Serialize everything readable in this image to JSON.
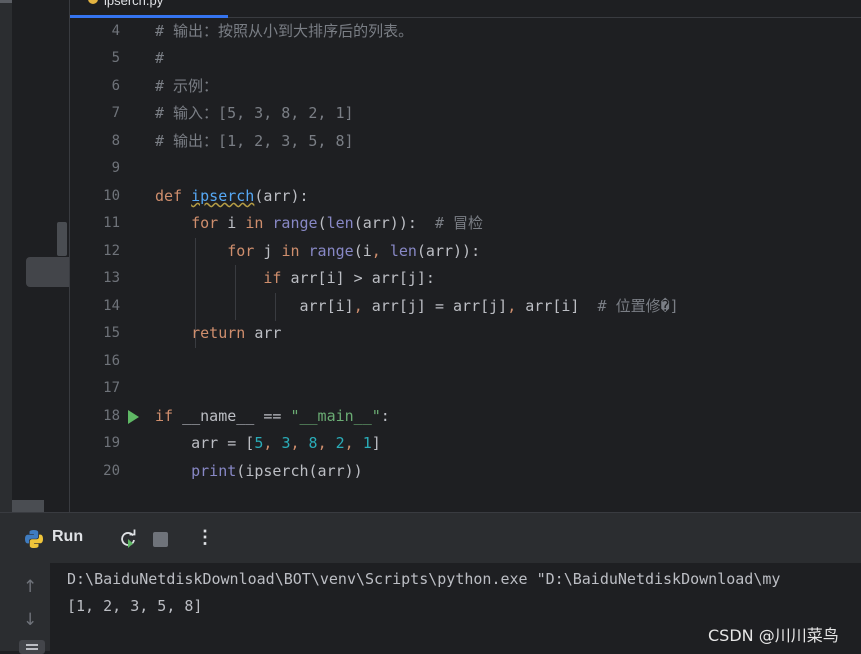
{
  "editor": {
    "active_tab": {
      "label": "ipserch.py"
    },
    "lines": [
      {
        "num": "4",
        "text": "# 输出：按照从小到大排序后的列表。"
      },
      {
        "num": "5",
        "text": "#"
      },
      {
        "num": "6",
        "text": "# 示例："
      },
      {
        "num": "7",
        "text": "# 输入：[5, 3, 8, 2, 1]"
      },
      {
        "num": "8",
        "text": "# 输出：[1, 2, 3, 5, 8]"
      },
      {
        "num": "9",
        "text": ""
      },
      {
        "num": "10",
        "text": "def ipserch(arr):"
      },
      {
        "num": "11",
        "text": "    for i in range(len(arr)):  # 冒检"
      },
      {
        "num": "12",
        "text": "        for j in range(i, len(arr)):"
      },
      {
        "num": "13",
        "text": "            if arr[i] > arr[j]:"
      },
      {
        "num": "14",
        "text": "                arr[i], arr[j] = arr[j], arr[i]  # 位置修�]"
      },
      {
        "num": "15",
        "text": "    return arr"
      },
      {
        "num": "16",
        "text": ""
      },
      {
        "num": "17",
        "text": ""
      },
      {
        "num": "18",
        "text": "if __name__ == \"__main__\":"
      },
      {
        "num": "19",
        "text": "    arr = [5, 3, 8, 2, 1]"
      },
      {
        "num": "20",
        "text": "    print(ipserch(arr))"
      }
    ]
  },
  "run_panel": {
    "title": "Run",
    "icons": [
      "python-icon",
      "rerun-icon",
      "stop-icon",
      "more-options-icon",
      "scroll-up-icon",
      "scroll-down-icon",
      "soft-wrap-icon"
    ],
    "console": [
      "D:\\BaiduNetdiskDownload\\BOT\\venv\\Scripts\\python.exe \"D:\\BaiduNetdiskDownload\\my",
      "[1, 2, 3, 5, 8]"
    ]
  },
  "watermark": "CSDN @川川菜鸟",
  "colors": {
    "background": "#1e1f22",
    "panel": "#2b2d30",
    "keyword": "#cf8e6d",
    "comment": "#7a7e85",
    "string": "#6aab73",
    "number": "#2aacb8",
    "builtin": "#8888c6",
    "function": "#56a8f5",
    "run_gutter": "#5fb865",
    "tab_underline": "#3574f0"
  }
}
